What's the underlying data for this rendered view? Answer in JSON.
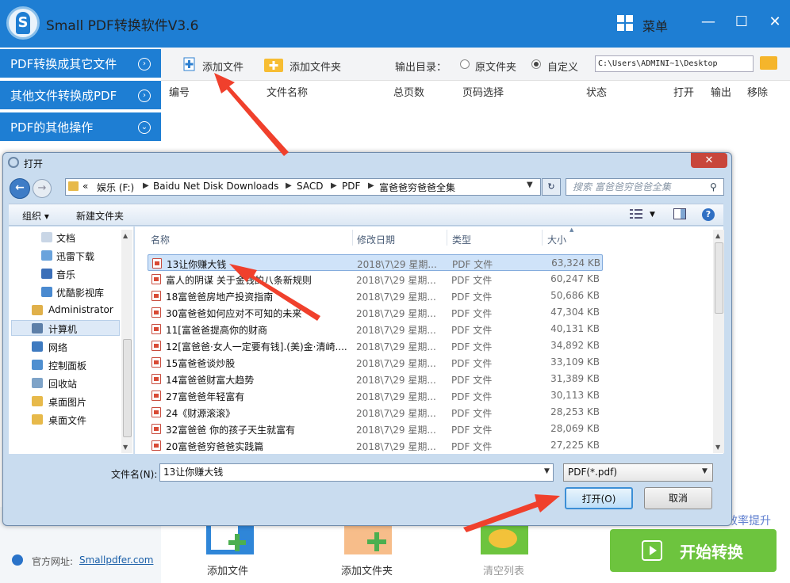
{
  "app": {
    "title": "Small PDF转换软件V3.6",
    "menu_label": "菜单",
    "window_controls": [
      "—",
      "☐",
      "✕"
    ]
  },
  "sidebar": {
    "items": [
      {
        "label": "PDF转换成其它文件",
        "icon": "chevron-right-circle-icon"
      },
      {
        "label": "其他文件转换成PDF",
        "icon": "chevron-right-circle-icon"
      },
      {
        "label": "PDF的其他操作",
        "icon": "chevron-down-circle-icon"
      }
    ],
    "website_label": "官方网址:",
    "website_link": "Smallpdfer.com"
  },
  "toolbar": {
    "add_file": "添加文件",
    "add_folder": "添加文件夹",
    "output_dir_label": "输出目录：",
    "radio_original": "原文件夹",
    "radio_custom": "自定义",
    "selected_radio": "自定义",
    "output_path": "C:\\Users\\ADMINI~1\\Desktop"
  },
  "table": {
    "columns": [
      "编号",
      "文件名称",
      "总页数",
      "页码选择",
      "状态",
      "打开",
      "输出",
      "移除"
    ]
  },
  "bottom": {
    "add_file": "添加文件",
    "add_folder": "添加文件夹",
    "clear_list": "清空列表",
    "efficiency_text": "效率提升",
    "start_button": "开始转换"
  },
  "dialog": {
    "title": "打开",
    "close": "✕",
    "breadcrumb": [
      "«",
      "娱乐 (F:)",
      "Baidu Net Disk Downloads",
      "SACD",
      "PDF",
      "富爸爸穷爸爸全集"
    ],
    "search_placeholder": "搜索 富爸爸穷爸爸全集",
    "organize": "组织 ▾",
    "new_folder": "新建文件夹",
    "nav_items": [
      {
        "label": "文档",
        "icon": "documents-icon"
      },
      {
        "label": "迅雷下载",
        "icon": "download-icon"
      },
      {
        "label": "音乐",
        "icon": "music-icon"
      },
      {
        "label": "优酷影视库",
        "icon": "video-library-icon"
      },
      {
        "label": "Administrator",
        "icon": "user-folder-icon"
      },
      {
        "label": "计算机",
        "icon": "computer-icon"
      },
      {
        "label": "网络",
        "icon": "network-icon"
      },
      {
        "label": "控制面板",
        "icon": "control-panel-icon"
      },
      {
        "label": "回收站",
        "icon": "recycle-bin-icon"
      },
      {
        "label": "桌面图片",
        "icon": "folder-icon"
      },
      {
        "label": "桌面文件",
        "icon": "folder-icon"
      }
    ],
    "selected_nav": "计算机",
    "file_columns": [
      "名称",
      "修改日期",
      "类型",
      "大小"
    ],
    "files": [
      {
        "name": "13让你赚大钱",
        "date": "2018\\7\\29 星期...",
        "type": "PDF 文件",
        "size": "63,324 KB"
      },
      {
        "name": "富人的阴谋  关于金钱的八条新规则",
        "date": "2018\\7\\29 星期...",
        "type": "PDF 文件",
        "size": "60,247 KB"
      },
      {
        "name": "18富爸爸房地产投资指南",
        "date": "2018\\7\\29 星期...",
        "type": "PDF 文件",
        "size": "50,686 KB"
      },
      {
        "name": "30富爸爸如何应对不可知的未来",
        "date": "2018\\7\\29 星期...",
        "type": "PDF 文件",
        "size": "47,304 KB"
      },
      {
        "name": "11[富爸爸提高你的财商",
        "date": "2018\\7\\29 星期...",
        "type": "PDF 文件",
        "size": "40,131 KB"
      },
      {
        "name": "12[富爸爸·女人一定要有钱].(美)金·清崎....",
        "date": "2018\\7\\29 星期...",
        "type": "PDF 文件",
        "size": "34,892 KB"
      },
      {
        "name": "15富爸爸谈炒股",
        "date": "2018\\7\\29 星期...",
        "type": "PDF 文件",
        "size": "33,109 KB"
      },
      {
        "name": "14富爸爸财富大趋势",
        "date": "2018\\7\\29 星期...",
        "type": "PDF 文件",
        "size": "31,389 KB"
      },
      {
        "name": "27富爸爸年轻富有",
        "date": "2018\\7\\29 星期...",
        "type": "PDF 文件",
        "size": "30,113 KB"
      },
      {
        "name": "24《财源滚滚》",
        "date": "2018\\7\\29 星期...",
        "type": "PDF 文件",
        "size": "28,253 KB"
      },
      {
        "name": "32富爸爸  你的孩子天生就富有",
        "date": "2018\\7\\29 星期...",
        "type": "PDF 文件",
        "size": "28,069 KB"
      },
      {
        "name": "20富爸爸穷爸爸实践篇",
        "date": "2018\\7\\29 星期...",
        "type": "PDF 文件",
        "size": "27,225 KB"
      }
    ],
    "selected_file": "13让你赚大钱",
    "filename_label": "文件名(N):",
    "filename_value": "13让你赚大钱",
    "filetype_value": "PDF(*.pdf)",
    "open_button": "打开(O)",
    "cancel_button": "取消"
  },
  "colors": {
    "brand_blue": "#1e7ed3",
    "start_green": "#6dc43e",
    "annotation_red": "#f0402c"
  }
}
